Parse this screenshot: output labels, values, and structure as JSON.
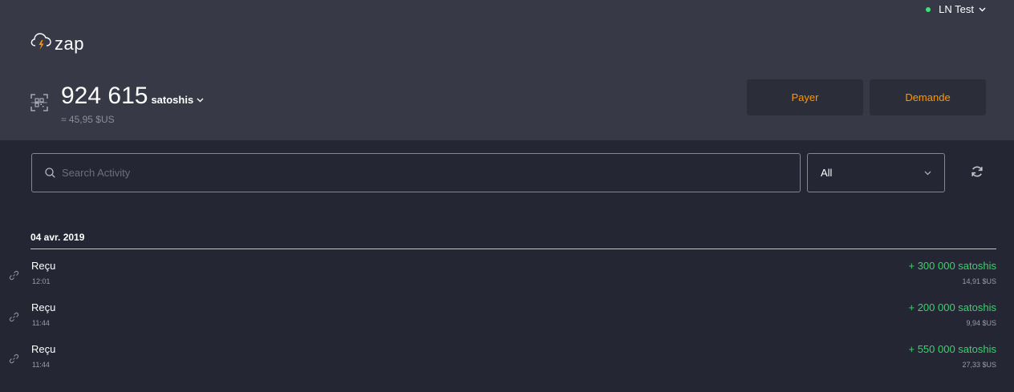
{
  "header": {
    "wallet_name": "LN Test",
    "logo_text": "zap",
    "balance_amount": "924 615",
    "balance_unit": "satoshis",
    "balance_fiat": "≈ 45,95 $US",
    "pay_label": "Payer",
    "request_label": "Demande"
  },
  "search": {
    "placeholder": "Search Activity",
    "value": ""
  },
  "filter": {
    "selected": "All"
  },
  "activity": {
    "date": "04 avr. 2019",
    "items": [
      {
        "type": "Reçu",
        "time": "12:01",
        "amount": "+ 300 000 satoshis",
        "fiat": "14,91 $US"
      },
      {
        "type": "Reçu",
        "time": "11:44",
        "amount": "+ 200 000 satoshis",
        "fiat": "9,94 $US"
      },
      {
        "type": "Reçu",
        "time": "11:44",
        "amount": "+ 550 000 satoshis",
        "fiat": "27,33 $US"
      }
    ]
  },
  "colors": {
    "accent": "#fd9800",
    "positive": "#39d36b",
    "online": "#39e673",
    "header_bg": "#373947",
    "body_bg": "#242633"
  },
  "icons": [
    "cloud-lightning-icon",
    "qr-code-icon",
    "chevron-down-icon",
    "search-icon",
    "refresh-icon",
    "link-icon"
  ]
}
